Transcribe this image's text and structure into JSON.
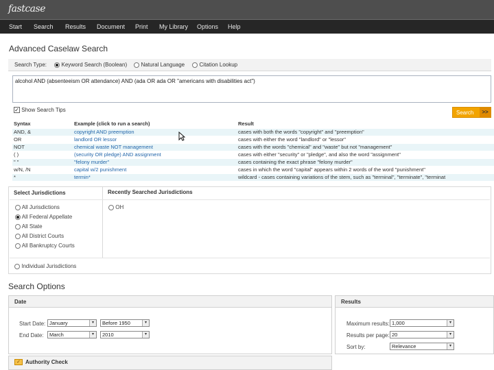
{
  "app": {
    "logo": "fastcase"
  },
  "nav": [
    "Start",
    "Search",
    "Results",
    "Document",
    "Print",
    "My Library",
    "Options",
    "Help"
  ],
  "page": {
    "title": "Advanced Caselaw Search"
  },
  "search_type": {
    "label": "Search Type:",
    "options": [
      {
        "label": "Keyword Search (Boolean)",
        "selected": true
      },
      {
        "label": "Natural Language",
        "selected": false
      },
      {
        "label": "Citation Lookup",
        "selected": false
      }
    ]
  },
  "query": {
    "value": "alcohol AND (absenteeism OR attendance) AND (ada OR ada OR \"americans with disabilities act\")"
  },
  "show_tips": {
    "label": "Show Search Tips",
    "checked": true
  },
  "search_button": {
    "label": "Search",
    "arrow": ">>"
  },
  "tips": {
    "headers": {
      "syntax": "Syntax",
      "example": "Example (click to run a search)",
      "result": "Result"
    },
    "rows": [
      {
        "syntax": "AND, &",
        "example": "copyright AND preemption",
        "result": "cases with both the words \"copyright\" and \"preemption\""
      },
      {
        "syntax": "OR",
        "example": "landlord OR lessor",
        "result": "cases with either the word \"landlord\" or \"lessor\""
      },
      {
        "syntax": "NOT",
        "example": "chemical waste NOT management",
        "result": "cases with the words \"chemical\" and \"waste\" but not \"management\""
      },
      {
        "syntax": "( )",
        "example": "(security OR pledge) AND assignment",
        "result": "cases with either \"security\" or \"pledge\", and also the word \"assignment\""
      },
      {
        "syntax": "\" \"",
        "example": "\"felony murder\"",
        "result": "cases containing the exact phrase \"felony murder\""
      },
      {
        "syntax": "w/N, /N",
        "example": "capital w/2 punishment",
        "result": "cases in which the word \"capital\" appears within 2 words of the word \"punishment\""
      },
      {
        "syntax": "*",
        "example": "termin*",
        "result": "wildcard - cases containing variations of the stem, such as \"terminal\", \"terminate\", \"terminat"
      }
    ]
  },
  "jurisdictions": {
    "title": "Select Jurisdictions",
    "options": [
      {
        "label": "All Jurisdictions",
        "selected": false
      },
      {
        "label": "All Federal Appellate",
        "selected": true
      },
      {
        "label": "All State",
        "selected": false
      },
      {
        "label": "All District Courts",
        "selected": false
      },
      {
        "label": "All Bankruptcy Courts",
        "selected": false
      },
      {
        "label": "Individual Jurisdictions",
        "selected": false
      }
    ]
  },
  "recent": {
    "title": "Recently Searched Jurisdictions",
    "options": [
      {
        "label": "OH",
        "selected": false
      }
    ]
  },
  "search_options": {
    "title": "Search Options"
  },
  "date": {
    "title": "Date",
    "start_label": "Start Date:",
    "start_month": "January",
    "start_year": "Before 1950",
    "end_label": "End Date:",
    "end_month": "March",
    "end_year": "2010"
  },
  "results": {
    "title": "Results",
    "max_label": "Maximum results:",
    "max_value": "1,000",
    "per_page_label": "Results per page:",
    "per_page_value": "20",
    "sort_label": "Sort by:",
    "sort_value": "Relevance"
  },
  "authority": {
    "title": "Authority Check"
  }
}
